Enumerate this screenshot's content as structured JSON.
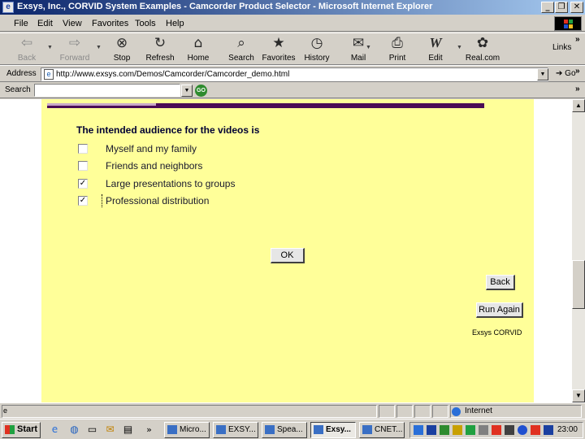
{
  "window": {
    "title": "Exsys, Inc., CORVID System Examples - Camcorder Product Selector - Microsoft Internet Explorer",
    "minimize": "_",
    "maximize": "❐",
    "close": "✕"
  },
  "menu": [
    "File",
    "Edit",
    "View",
    "Favorites",
    "Tools",
    "Help"
  ],
  "toolbar": {
    "buttons": [
      {
        "label": "Back",
        "icon": "back-arrow-icon",
        "glyph": "⇦"
      },
      {
        "label": "Forward",
        "icon": "forward-arrow-icon",
        "glyph": "⇨"
      },
      {
        "label": "Stop",
        "icon": "stop-icon",
        "glyph": "⊗"
      },
      {
        "label": "Refresh",
        "icon": "refresh-icon",
        "glyph": "↻"
      },
      {
        "label": "Home",
        "icon": "home-icon",
        "glyph": "⌂"
      },
      {
        "label": "Search",
        "icon": "search-icon",
        "glyph": "⌕"
      },
      {
        "label": "Favorites",
        "icon": "favorites-icon",
        "glyph": "★"
      },
      {
        "label": "History",
        "icon": "history-icon",
        "glyph": "◷"
      },
      {
        "label": "Mail",
        "icon": "mail-icon",
        "glyph": "✉"
      },
      {
        "label": "Print",
        "icon": "print-icon",
        "glyph": "⎙"
      },
      {
        "label": "Edit",
        "icon": "edit-icon",
        "glyph": "W"
      },
      {
        "label": "Real.com",
        "icon": "realcom-icon",
        "glyph": "✿"
      }
    ],
    "links_label": "Links"
  },
  "address": {
    "label": "Address",
    "url": "http://www.exsys.com/Demos/Camcorder/Camcorder_demo.html",
    "go_label": "Go"
  },
  "search": {
    "label": "Search",
    "value": "",
    "go_label": "GO"
  },
  "page": {
    "question": "The intended audience for the videos is",
    "options": [
      {
        "label": "Myself and my family",
        "checked": false
      },
      {
        "label": "Friends and neighbors",
        "checked": false
      },
      {
        "label": "Large presentations to groups",
        "checked": true
      },
      {
        "label": "Professional distribution",
        "checked": true
      }
    ],
    "check_mark": "✓",
    "ok_label": "OK",
    "back_label": "Back",
    "run_again_label": "Run Again",
    "credit": "Exsys CORVID",
    "colors": {
      "panel": "#ffff99",
      "strip": "#4b0c55"
    }
  },
  "status": {
    "left": "",
    "zone": "Internet"
  },
  "taskbar": {
    "start_label": "Start",
    "chevron": "»",
    "tasks": [
      {
        "label": "Micro...",
        "active": false
      },
      {
        "label": "EXSY...",
        "active": false
      },
      {
        "label": "Spea...",
        "active": false
      },
      {
        "label": "Exsy...",
        "active": true
      },
      {
        "label": "CNET...",
        "active": false
      }
    ],
    "clock": "23:00"
  }
}
